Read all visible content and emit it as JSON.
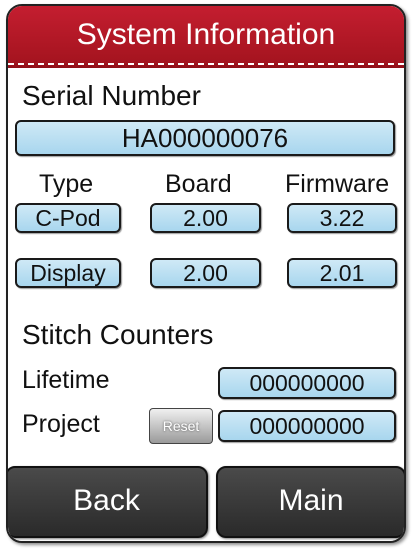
{
  "title": "System Information",
  "serial": {
    "label": "Serial Number",
    "value": "HA000000076"
  },
  "columns": {
    "type": "Type",
    "board": "Board",
    "firmware": "Firmware"
  },
  "rows": [
    {
      "type": "C-Pod",
      "board": "2.00",
      "firmware": "3.22"
    },
    {
      "type": "Display",
      "board": "2.00",
      "firmware": "2.01"
    }
  ],
  "counters": {
    "heading": "Stitch Counters",
    "lifetime_label": "Lifetime",
    "lifetime_value": "000000000",
    "project_label": "Project",
    "project_value": "000000000",
    "reset_label": "Reset"
  },
  "buttons": {
    "back": "Back",
    "main": "Main"
  },
  "colors": {
    "title_bar": "#b81826",
    "field_fill": "#b8def1",
    "button_fill": "#3a3a3a"
  }
}
